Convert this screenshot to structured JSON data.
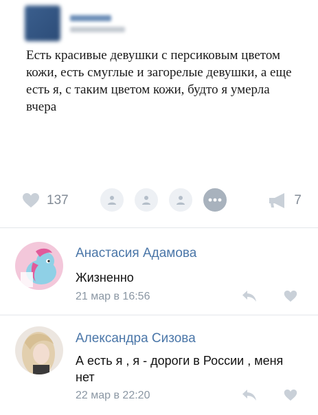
{
  "post": {
    "text": "Есть красивые девушки с персиковым цветом кожи, есть смуглые и загорелые девушки, а еще есть я, с таким цветом кожи, будто я умерла вчера",
    "likes_count": "137",
    "shares_count": "7",
    "icons": {
      "like": "heart-icon",
      "share": "megaphone-icon",
      "liker": "person-icon",
      "more": "ellipsis-icon"
    }
  },
  "comments": [
    {
      "author": "Анастасия Адамова",
      "text": "Жизненно",
      "date": "21 мар в 16:56",
      "avatar": "cartoon-pony-avatar"
    },
    {
      "author": "Александра Сизова",
      "text": "А есть я , я - дороги в России , меня нет",
      "date": "22 мар в 22:20",
      "avatar": "photo-blonde-avatar"
    }
  ],
  "colors": {
    "link": "#4a76a8",
    "muted": "#828b96",
    "icon": "#c9d0d8",
    "divider": "#e3e6ea"
  }
}
